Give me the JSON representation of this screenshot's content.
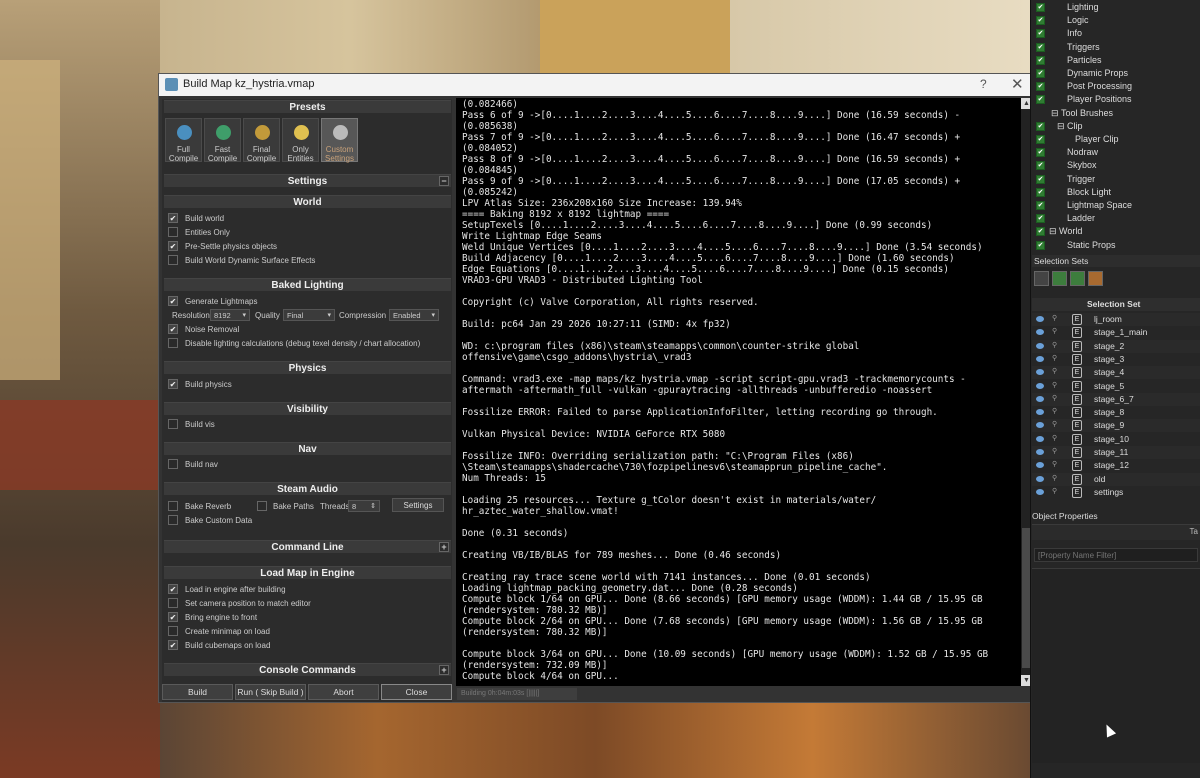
{
  "window": {
    "title": "Build Map kz_hystria.vmap",
    "help": "?",
    "close": "✕"
  },
  "presets": {
    "header": "Presets",
    "items": [
      {
        "line1": "Full",
        "line2": "Compile",
        "color": "#4a8fbf"
      },
      {
        "line1": "Fast",
        "line2": "Compile",
        "color": "#3f9e6a"
      },
      {
        "line1": "Final",
        "line2": "Compile",
        "color": "#c29a3a"
      },
      {
        "line1": "Only",
        "line2": "Entities",
        "color": "#e0c050"
      },
      {
        "line1": "Custom",
        "line2": "Settings",
        "color": "#bbbbbb"
      }
    ]
  },
  "settings": {
    "header": "Settings",
    "collapse": "−"
  },
  "world": {
    "header": "World",
    "options": [
      {
        "label": "Build world",
        "checked": "✔"
      },
      {
        "label": "Entities Only",
        "checked": ""
      },
      {
        "label": "Pre-Settle physics objects",
        "checked": "✔"
      },
      {
        "label": "Build World Dynamic Surface Effects",
        "checked": ""
      }
    ]
  },
  "baked": {
    "header": "Baked Lighting",
    "generate": {
      "label": "Generate Lightmaps",
      "checked": "✔"
    },
    "resolution_label": "Resolution",
    "resolution_value": "8192",
    "quality_label": "Quality",
    "quality_value": "Final",
    "compression_label": "Compression",
    "compression_value": "Enabled",
    "noise": {
      "label": "Noise Removal",
      "checked": "✔"
    },
    "disable": {
      "label": "Disable lighting calculations (debug texel density / chart allocation)",
      "checked": ""
    }
  },
  "physics": {
    "header": "Physics",
    "build": {
      "label": "Build physics",
      "checked": "✔"
    }
  },
  "visibility": {
    "header": "Visibility",
    "build": {
      "label": "Build vis",
      "checked": ""
    }
  },
  "nav": {
    "header": "Nav",
    "build": {
      "label": "Build nav",
      "checked": ""
    }
  },
  "steam_audio": {
    "header": "Steam Audio",
    "reverb": "Bake Reverb",
    "paths": "Bake Paths",
    "threads_label": "Threads",
    "threads_value": "8",
    "settings_btn": "Settings",
    "custom": "Bake Custom Data"
  },
  "command_line": {
    "header": "Command Line",
    "plus": "+"
  },
  "load_map": {
    "header": "Load Map in Engine",
    "options": [
      {
        "label": "Load in engine after building",
        "checked": "✔"
      },
      {
        "label": "Set camera position to match editor",
        "checked": ""
      },
      {
        "label": "Bring engine to front",
        "checked": "✔"
      },
      {
        "label": "Create minimap on load",
        "checked": ""
      },
      {
        "label": "Build cubemaps on load",
        "checked": "✔"
      }
    ]
  },
  "console_commands": {
    "header": "Console Commands",
    "plus": "+"
  },
  "buttons": {
    "build": "Build",
    "run": "Run ( Skip Build )",
    "abort": "Abort",
    "close": "Close"
  },
  "status": "Building 0h:04m:03s [|||||]",
  "console_lines": [
    "(0.082466)",
    "Pass 6 of 9 ->[0....1....2....3....4....5....6....7....8....9....] Done (16.59 seconds) -",
    "(0.085638)",
    "Pass 7 of 9 ->[0....1....2....3....4....5....6....7....8....9....] Done (16.47 seconds) +",
    "(0.084052)",
    "Pass 8 of 9 ->[0....1....2....3....4....5....6....7....8....9....] Done (16.59 seconds) +",
    "(0.084845)",
    "Pass 9 of 9 ->[0....1....2....3....4....5....6....7....8....9....] Done (17.05 seconds) +",
    "(0.085242)",
    "LPV Atlas Size: 236x208x160 Size Increase: 139.94%",
    "==== Baking 8192 x 8192 lightmap ====",
    "SetupTexels [0....1....2....3....4....5....6....7....8....9....] Done (0.99 seconds)",
    "Write Lightmap Edge Seams",
    "Weld Unique Vertices [0....1....2....3....4....5....6....7....8....9....] Done (3.54 seconds)",
    "Build Adjacency [0....1....2....3....4....5....6....7....8....9....] Done (1.60 seconds)",
    "Edge Equations [0....1....2....3....4....5....6....7....8....9....] Done (0.15 seconds)",
    "VRAD3-GPU VRAD3 - Distributed Lighting Tool",
    "",
    "Copyright (c) Valve Corporation, All rights reserved.",
    "",
    "Build: pc64 Jan 29 2026 10:27:11 (SIMD: 4x fp32)",
    "",
    "WD: c:\\program files (x86)\\steam\\steamapps\\common\\counter-strike global",
    "offensive\\game\\csgo_addons\\hystria\\_vrad3",
    "",
    "Command: vrad3.exe -map maps/kz_hystria.vmap -script script-gpu.vrad3 -trackmemorycounts -",
    "aftermath -aftermath_full -vulkan -gpuraytracing -allthreads -unbufferedio -noassert",
    "",
    "Fossilize ERROR: Failed to parse ApplicationInfoFilter, letting recording go through.",
    "",
    "Vulkan Physical Device: NVIDIA GeForce RTX 5080",
    "",
    "Fossilize INFO: Overriding serialization path: \"C:\\Program Files (x86)",
    "\\Steam\\steamapps\\shadercache\\730\\fozpipelinesv6\\steamapprun_pipeline_cache\".",
    "Num Threads: 15",
    "",
    "Loading 25 resources... Texture g_tColor doesn't exist in materials/water/",
    "hr_aztec_water_shallow.vmat!",
    "",
    "Done (0.31 seconds)",
    "",
    "Creating VB/IB/BLAS for 789 meshes... Done (0.46 seconds)",
    "",
    "Creating ray trace scene world with 7141 instances... Done (0.01 seconds)",
    "Loading lightmap_packing_geometry.dat... Done (0.28 seconds)",
    "Compute block 1/64 on GPU... Done (8.66 seconds) [GPU memory usage (WDDM): 1.44 GB / 15.95 GB",
    "(rendersystem: 780.32 MB)]",
    "Compute block 2/64 on GPU... Done (7.68 seconds) [GPU memory usage (WDDM): 1.56 GB / 15.95 GB",
    "(rendersystem: 780.32 MB)]",
    "",
    "Compute block 3/64 on GPU... Done (10.09 seconds) [GPU memory usage (WDDM): 1.52 GB / 15.95 GB",
    "(rendersystem: 732.09 MB)]",
    "Compute block 4/64 on GPU..."
  ],
  "outliner": {
    "items": [
      {
        "label": "Lighting",
        "check": "✔"
      },
      {
        "label": "Logic",
        "check": "✔"
      },
      {
        "label": "Info",
        "check": "✔"
      },
      {
        "label": "Triggers",
        "check": "✔"
      },
      {
        "label": "Particles",
        "check": "✔"
      },
      {
        "label": "Dynamic Props",
        "check": "✔"
      },
      {
        "label": "Post Processing",
        "check": "✔"
      },
      {
        "label": "Player Positions",
        "check": "✔"
      }
    ],
    "tool_brushes": "Tool Brushes",
    "clip": "Clip",
    "player_clip": "Player Clip",
    "sub_items": [
      "Nodraw",
      "Skybox",
      "Trigger",
      "Block Light",
      "Lightmap Space",
      "Ladder"
    ],
    "world": "World",
    "static_props": "Static Props"
  },
  "selection_sets": {
    "title": "Selection Sets",
    "column": "Selection Set",
    "items": [
      "lj_room",
      "stage_1_main",
      "stage_2",
      "stage_3",
      "stage_4",
      "stage_5",
      "stage_6_7",
      "stage_8",
      "stage_9",
      "stage_10",
      "stage_11",
      "stage_12",
      "old",
      "settings"
    ]
  },
  "object_properties": {
    "title": "Object Properties",
    "filter_placeholder": "[Property Name Filter]",
    "col_label": "Ta"
  }
}
